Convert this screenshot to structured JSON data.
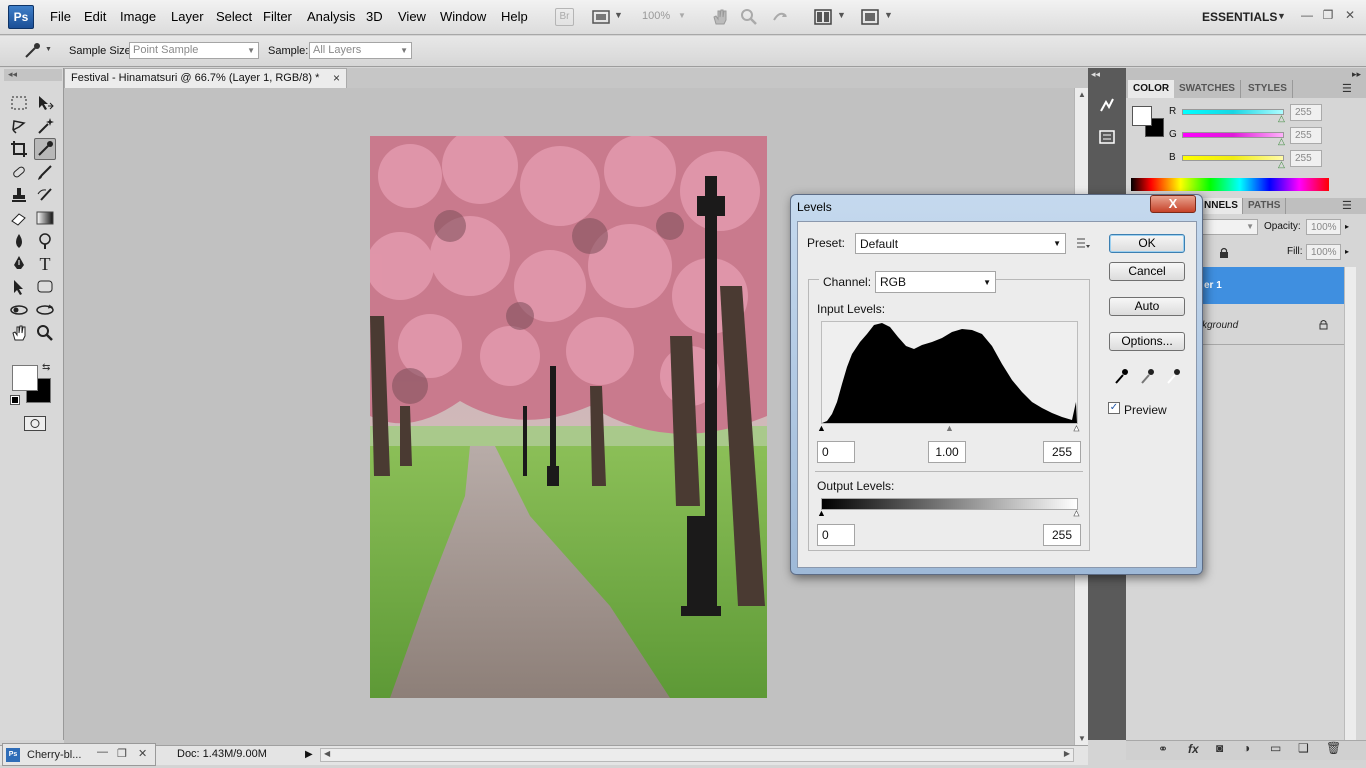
{
  "app": {
    "logo": "Ps"
  },
  "menubar": {
    "items": [
      "File",
      "Edit",
      "Image",
      "Layer",
      "Select",
      "Filter",
      "Analysis",
      "3D",
      "View",
      "Window",
      "Help"
    ],
    "br": "Br",
    "zoom": "100%",
    "workspace": "ESSENTIALS"
  },
  "options": {
    "sample_size_label": "Sample Size:",
    "sample_size_value": "Point Sample",
    "sample_label": "Sample:",
    "sample_value": "All Layers"
  },
  "document": {
    "tab_title": "Festival - Hinamatsuri @ 66.7% (Layer 1, RGB/8) *",
    "close": "×",
    "minimized_title": "Cherry-bl...",
    "doc_size": "Doc: 1.43M/9.00M"
  },
  "color_panel": {
    "tabs": [
      "COLOR",
      "SWATCHES",
      "STYLES"
    ],
    "channels": [
      {
        "label": "R",
        "value": "255",
        "color": "#19d6e3"
      },
      {
        "label": "G",
        "value": "255",
        "color": "#e01ad9"
      },
      {
        "label": "B",
        "value": "255",
        "color": "#f0ec13"
      }
    ]
  },
  "layers_panel": {
    "tabs": [
      "NNELS",
      "PATHS"
    ],
    "opacity_label": "Opacity:",
    "opacity_value": "100%",
    "fill_label": "Fill:",
    "fill_value": "100%",
    "layer1": "er 1",
    "background": "kground"
  },
  "levels_dialog": {
    "title": "Levels",
    "close": "X",
    "preset_label": "Preset:",
    "preset_value": "Default",
    "channel_label": "Channel:",
    "channel_value": "RGB",
    "input_label": "Input Levels:",
    "input_black": "0",
    "input_gamma": "1.00",
    "input_white": "255",
    "output_label": "Output Levels:",
    "output_black": "0",
    "output_white": "255",
    "buttons": {
      "ok": "OK",
      "cancel": "Cancel",
      "auto": "Auto",
      "options": "Options..."
    },
    "preview_label": "Preview",
    "preview_checked": true
  },
  "colors": {
    "accent": "#3f8fe0",
    "dialog_frame": "#9eb9d8"
  }
}
